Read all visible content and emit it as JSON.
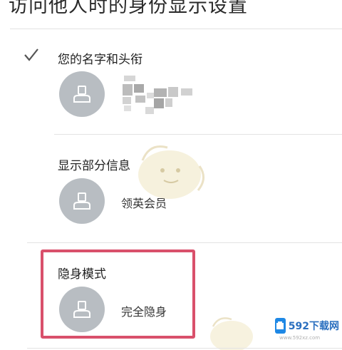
{
  "page": {
    "title": "访问他人时的身份显示设置"
  },
  "options": [
    {
      "title": "您的名字和头衔",
      "value": "",
      "selected": true,
      "value_blurred": true
    },
    {
      "title": "显示部分信息",
      "value": "领英会员",
      "selected": false
    },
    {
      "title": "隐身模式",
      "value": "完全隐身",
      "selected": false,
      "highlighted": true
    }
  ],
  "watermark": {
    "logo_text": "592下载网",
    "sub_text": "www.592xz.com"
  },
  "colors": {
    "highlight_border": "#d9506b",
    "avatar_bg": "#b8bdc2",
    "check_color": "#555555",
    "divider": "#e3e3e3"
  },
  "icons": {
    "check": "check-icon",
    "avatar": "person-icon"
  }
}
